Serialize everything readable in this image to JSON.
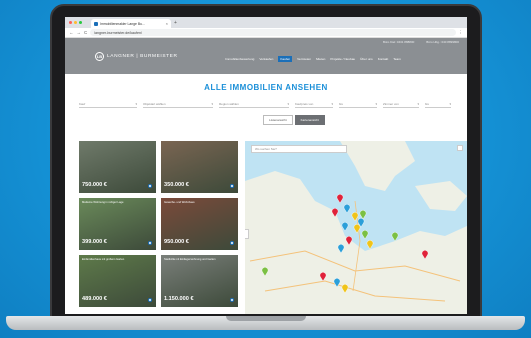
{
  "browser": {
    "tab_title": "Immobilienmakler Lange Bu...",
    "tab_close": "×",
    "new_tab": "+",
    "url": "langner-burmeister.de/kaufen/",
    "nav_back": "←",
    "nav_forward": "→",
    "nav_reload": "C",
    "menu": "⋮"
  },
  "site": {
    "top_contacts": [
      "Büro Kiel: 0431 888800",
      "Büro Hbg.: 040 8899800"
    ],
    "logo_mark": "LB",
    "logo_text": "LANGNER | BURMEISTER",
    "nav": [
      "Immobilienbewertung",
      "Verkaufen",
      "Kaufen",
      "Vermieten",
      "Mieten",
      "Projekte / Neubau",
      "Über uns",
      "Kontakt",
      "Team"
    ],
    "nav_active_index": 2
  },
  "page": {
    "title": "ALLE IMMOBILIEN ANSEHEN",
    "filters": [
      {
        "label": "Kauf",
        "arrow": "▾"
      },
      {
        "label": "Objektart wählen",
        "arrow": "▾"
      },
      {
        "label": "Region wählen",
        "arrow": "▾"
      },
      {
        "label": "Kaufpreis von",
        "arrow": "▾"
      },
      {
        "label": "bis",
        "arrow": "▾"
      },
      {
        "label": "Zimmer von",
        "arrow": "▾"
      },
      {
        "label": "bis",
        "arrow": "▾"
      }
    ],
    "toggles": [
      "Listenansicht",
      "Kartenansicht"
    ],
    "active_toggle": 1
  },
  "listings": [
    {
      "label": "",
      "price": "750.000 €",
      "color": "#6f7a6a"
    },
    {
      "label": "",
      "price": "350.000 €",
      "color": "#7a6552"
    },
    {
      "label": "Moderne Wohnung in ruhiger Lage",
      "price": "399.000 €",
      "color": "#6a8a5a"
    },
    {
      "label": "Gewerbe- und Wohnhaus",
      "price": "950.000 €",
      "color": "#7b4a3a"
    },
    {
      "label": "Einfamilienhaus mit großem Garten",
      "price": "489.000 €",
      "color": "#5e7a4a"
    },
    {
      "label": "Stadtvilla mit Einliegerwohnung und Garten",
      "price": "1.150.000 €",
      "color": "#7a7f7a"
    }
  ],
  "map": {
    "search_placeholder": "Wo suchen Sie?",
    "sea_color": "#bfe3f3",
    "land_color": "#eef0e6",
    "pin_colors": [
      "#e0223a",
      "#2b9fd9",
      "#f0c419",
      "#7bc043"
    ]
  }
}
